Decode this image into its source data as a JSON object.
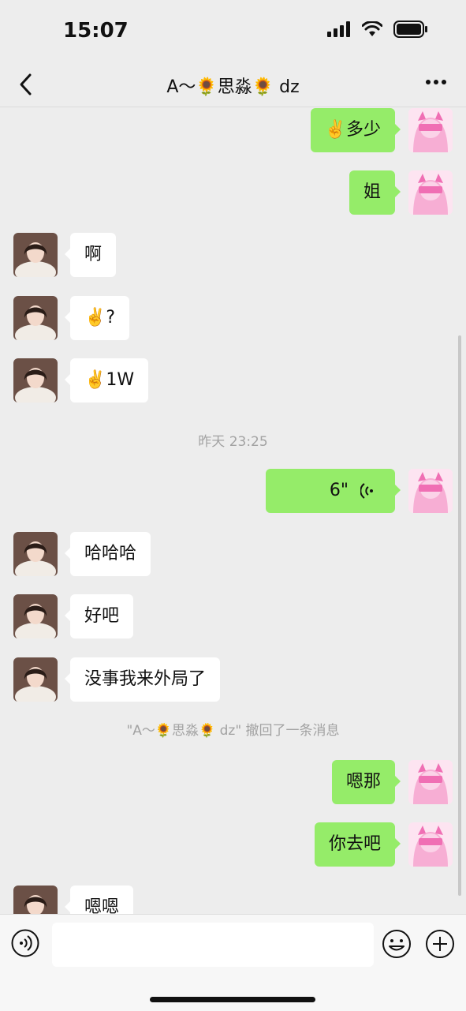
{
  "status": {
    "time": "15:07",
    "icons": [
      "signal-icon",
      "wifi-icon",
      "battery-icon"
    ]
  },
  "nav": {
    "title": "A～🌻思淼🌻 dz",
    "back_icon": "chevron-left-icon",
    "more_icon": "more-dots-icon"
  },
  "messages": [
    {
      "side": "right",
      "text": "✌️多少"
    },
    {
      "side": "right",
      "text": "姐"
    },
    {
      "side": "left",
      "text": "啊"
    },
    {
      "side": "left",
      "text": "✌️?"
    },
    {
      "side": "left",
      "text": "✌️1W"
    },
    {
      "type": "timestamp",
      "text": "昨天 23:25"
    },
    {
      "side": "right",
      "type": "voice",
      "text": "6\""
    },
    {
      "side": "left",
      "text": "哈哈哈"
    },
    {
      "side": "left",
      "text": "好吧"
    },
    {
      "side": "left",
      "text": "没事我来外局了"
    },
    {
      "type": "recall",
      "text": "\"A～🌻思淼🌻 dz\" 撤回了一条消息"
    },
    {
      "side": "right",
      "text": "嗯那"
    },
    {
      "side": "right",
      "text": "你去吧"
    },
    {
      "side": "left",
      "text": "嗯嗯"
    }
  ],
  "input_bar": {
    "voice_icon": "voice-input-icon",
    "emoji_icon": "emoji-icon",
    "plus_icon": "plus-icon",
    "input_value": ""
  },
  "colors": {
    "background": "#ededed",
    "self_bubble": "#95ec69",
    "other_bubble": "#ffffff",
    "system_text": "#a2a2a2"
  }
}
